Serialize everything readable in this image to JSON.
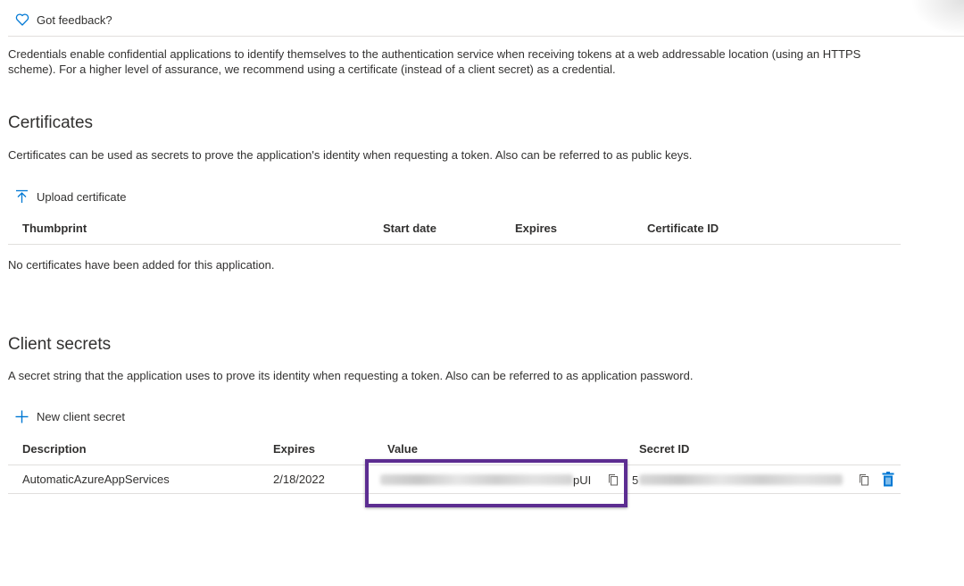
{
  "feedback": {
    "label": "Got feedback?"
  },
  "intro": "Credentials enable confidential applications to identify themselves to the authentication service when receiving tokens at a web addressable location (using an HTTPS scheme). For a higher level of assurance, we recommend using a certificate (instead of a client secret) as a credential.",
  "certificates": {
    "title": "Certificates",
    "description": "Certificates can be used as secrets to prove the application's identity when requesting a token. Also can be referred to as public keys.",
    "upload_label": "Upload certificate",
    "columns": [
      "Thumbprint",
      "Start date",
      "Expires",
      "Certificate ID"
    ],
    "empty_text": "No certificates have been added for this application."
  },
  "client_secrets": {
    "title": "Client secrets",
    "description": "A secret string that the application uses to prove its identity when requesting a token. Also can be referred to as application password.",
    "new_label": "New client secret",
    "columns": [
      "Description",
      "Expires",
      "Value",
      "Secret ID"
    ],
    "rows": [
      {
        "description": "AutomaticAzureAppServices",
        "expires": "2/18/2022",
        "value_suffix": "pUI",
        "secret_id_prefix": "5"
      }
    ]
  },
  "colors": {
    "accent": "#0078d4",
    "highlight": "#5c2d91",
    "text": "#323130",
    "divider": "#e1dfdd"
  },
  "icons": [
    "heart-icon",
    "upload-icon",
    "add-icon",
    "copy-icon",
    "delete-icon"
  ]
}
